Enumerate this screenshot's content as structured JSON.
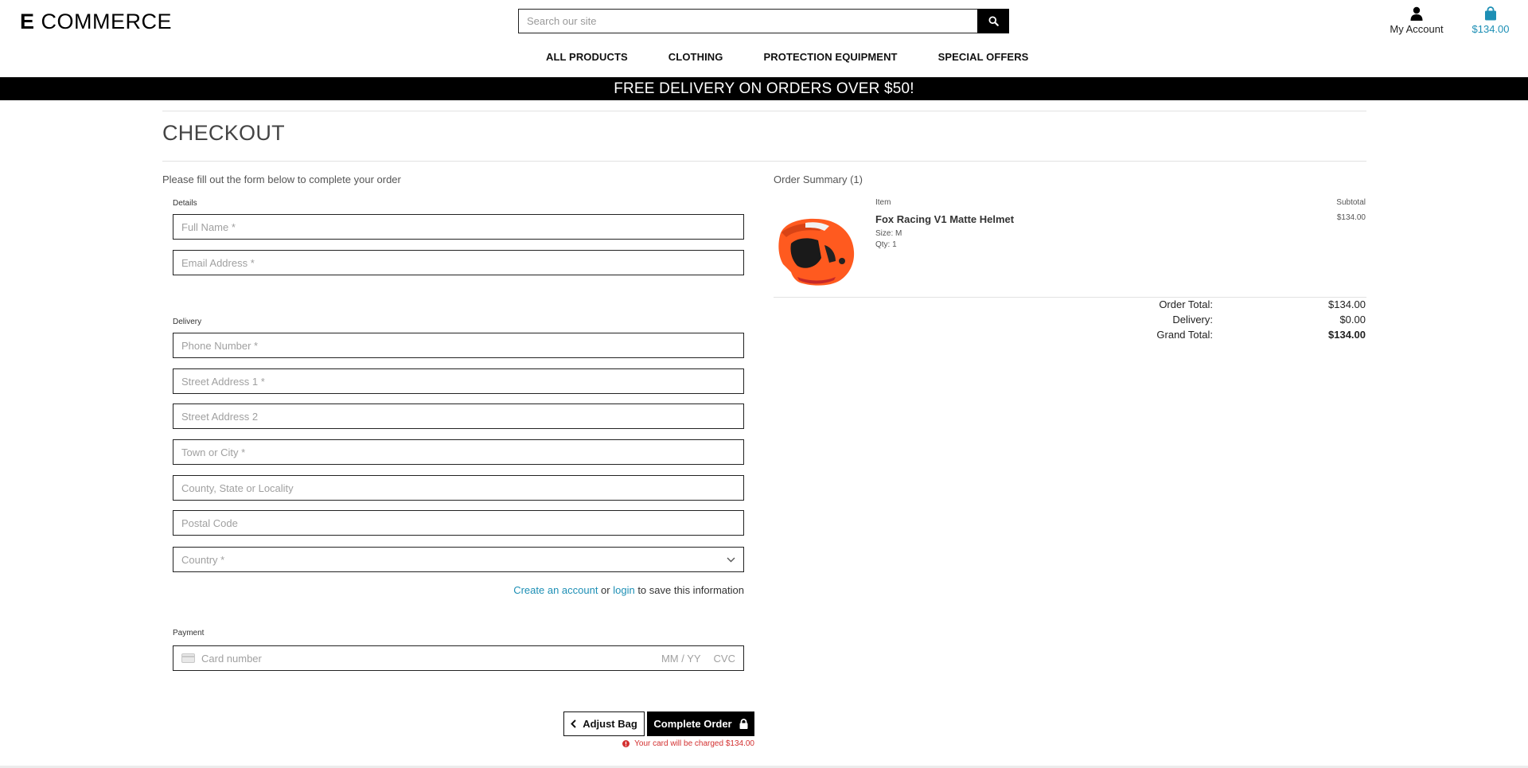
{
  "header": {
    "logo_initial": "E",
    "logo_rest": " COMMERCE",
    "search_placeholder": "Search our site",
    "account_label": "My Account",
    "bag_total": "$134.00"
  },
  "nav": {
    "items": [
      "ALL PRODUCTS",
      "CLOTHING",
      "PROTECTION EQUIPMENT",
      "SPECIAL OFFERS"
    ]
  },
  "banner": {
    "text": "FREE DELIVERY ON ORDERS OVER $50!"
  },
  "checkout": {
    "title": "CHECKOUT",
    "intro": "Please fill out the form below to complete your order",
    "details_label": "Details",
    "delivery_label": "Delivery",
    "payment_label": "Payment",
    "placeholders": {
      "full_name": "Full Name *",
      "email": "Email Address *",
      "phone": "Phone Number *",
      "street1": "Street Address 1 *",
      "street2": "Street Address 2",
      "town": "Town or City *",
      "county": "County, State or Locality",
      "postcode": "Postal Code",
      "country": "Country *"
    },
    "save_info": {
      "create_link": "Create an account",
      "or": " or ",
      "login_link": "login",
      "suffix": " to save this information"
    },
    "card": {
      "number_placeholder": "Card number",
      "exp_placeholder": "MM / YY",
      "cvc_placeholder": "CVC"
    },
    "adjust_bag": "Adjust Bag",
    "complete_order": "Complete Order",
    "charge_text": "Your card will be charged $134.00"
  },
  "summary": {
    "title": "Order Summary (1)",
    "item_col": "Item",
    "subtotal_col": "Subtotal",
    "product": {
      "name": "Fox Racing V1 Matte Helmet",
      "size": "Size: M",
      "qty": "Qty: 1",
      "subtotal": "$134.00"
    },
    "order_total_label": "Order Total:",
    "order_total": "$134.00",
    "delivery_label": "Delivery:",
    "delivery": "$0.00",
    "grand_total_label": "Grand Total:",
    "grand_total": "$134.00"
  },
  "colors": {
    "link": "#1d8fb5",
    "error": "#d32f2f",
    "helmet": "#ff5a1f"
  }
}
